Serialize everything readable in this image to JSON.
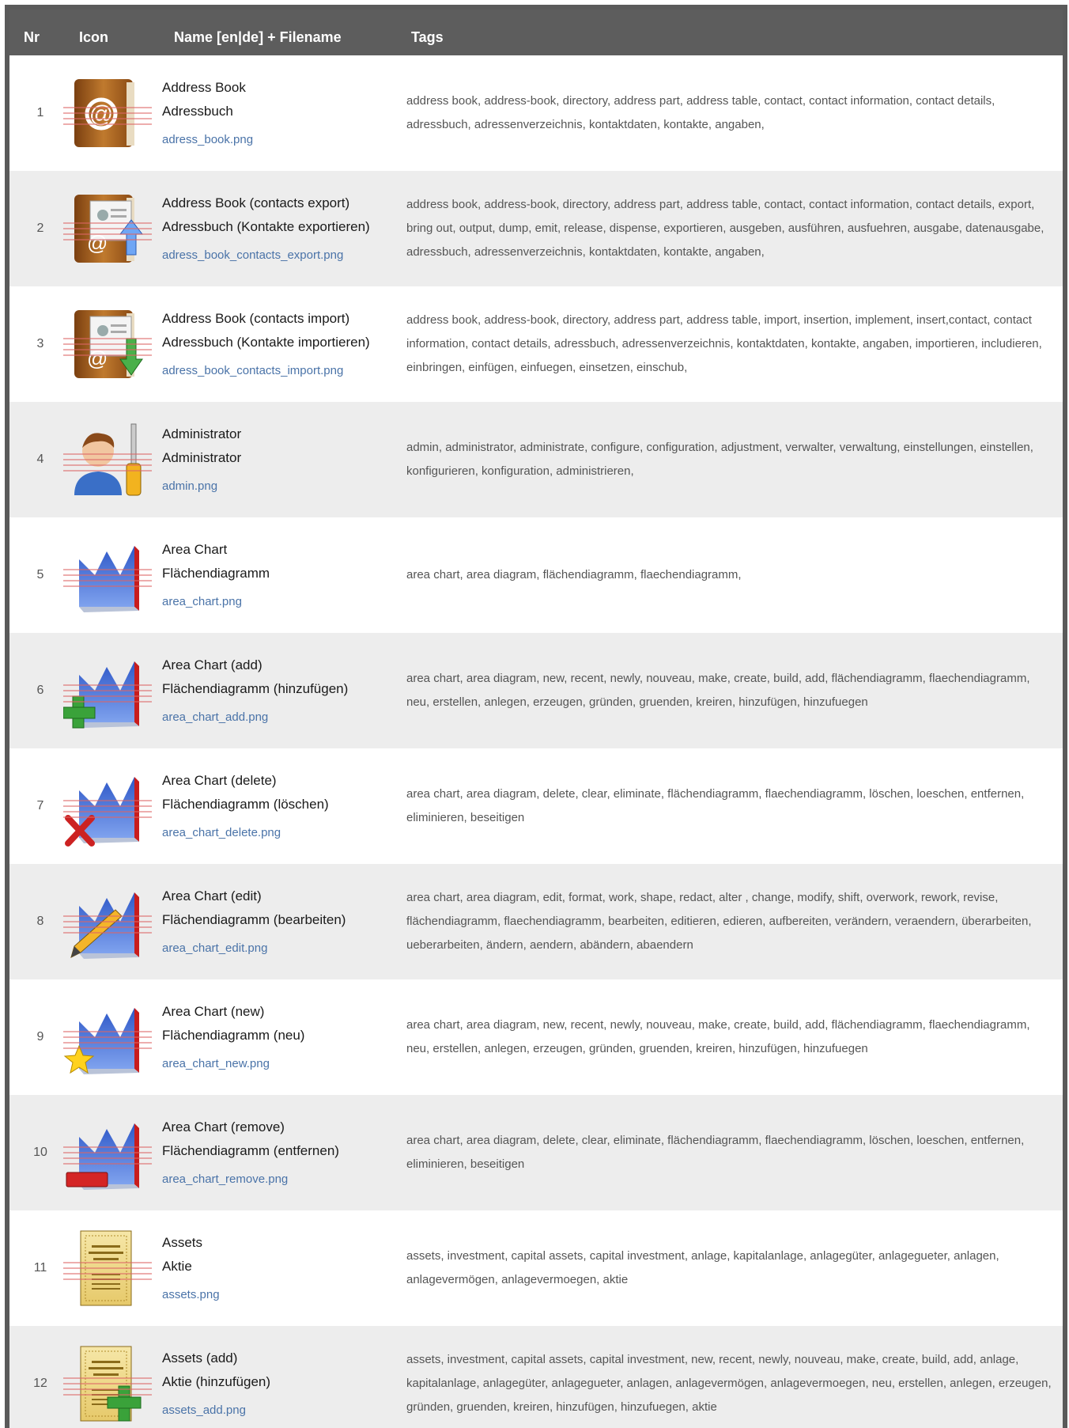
{
  "header": {
    "nr": "Nr",
    "icon": "Icon",
    "name": "Name [en|de] + Filename",
    "tags": "Tags"
  },
  "colors": {
    "header_bg": "#5d5d5d",
    "link": "#4a73a8",
    "row_alt": "#ededed"
  },
  "rows": [
    {
      "nr": "1",
      "icon": "address-book-icon",
      "en": "Address Book",
      "de": "Adressbuch",
      "file": "adress_book.png",
      "tags": "address book, address-book, directory, address part, address table, contact, contact information, contact details, adressbuch, adressenverzeichnis, kontaktdaten, kontakte, angaben,"
    },
    {
      "nr": "2",
      "icon": "address-book-export-icon",
      "en": "Address Book (contacts export)",
      "de": "Adressbuch (Kontakte exportieren)",
      "file": "adress_book_contacts_export.png",
      "tags": "address book, address-book, directory, address part, address table, contact, contact information, contact details, export, bring out, output, dump, emit, release, dispense, exportieren, ausgeben, ausführen, ausfuehren, ausgabe, datenausgabe, adressbuch, adressenverzeichnis, kontaktdaten, kontakte, angaben,"
    },
    {
      "nr": "3",
      "icon": "address-book-import-icon",
      "en": "Address Book (contacts import)",
      "de": "Adressbuch (Kontakte importieren)",
      "file": "adress_book_contacts_import.png",
      "tags": "address book, address-book, directory, address part, address table, import, insertion, implement, insert,contact, contact information, contact details, adressbuch, adressenverzeichnis, kontaktdaten, kontakte, angaben, importieren, includieren, einbringen, einfügen, einfuegen, einsetzen, einschub,"
    },
    {
      "nr": "4",
      "icon": "administrator-icon",
      "en": "Administrator",
      "de": "Administrator",
      "file": "admin.png",
      "tags": "admin, administrator, administrate, configure, configuration, adjustment, verwalter, verwaltung, einstellungen, einstellen, konfigurieren, konfiguration, administrieren,"
    },
    {
      "nr": "5",
      "icon": "area-chart-icon",
      "en": "Area Chart",
      "de": "Flächendiagramm",
      "file": "area_chart.png",
      "tags": "area chart, area diagram, flächendiagramm, flaechendiagramm,"
    },
    {
      "nr": "6",
      "icon": "area-chart-add-icon",
      "en": "Area Chart (add)",
      "de": "Flächendiagramm (hinzufügen)",
      "file": "area_chart_add.png",
      "tags": "area chart, area diagram, new, recent, newly, nouveau, make, create, build, add, flächendiagramm, flaechendiagramm, neu, erstellen, anlegen, erzeugen, gründen, gruenden, kreiren, hinzufügen, hinzufuegen"
    },
    {
      "nr": "7",
      "icon": "area-chart-delete-icon",
      "en": "Area Chart (delete)",
      "de": "Flächendiagramm (löschen)",
      "file": "area_chart_delete.png",
      "tags": "area chart, area diagram, delete, clear, eliminate, flächendiagramm, flaechendiagramm, löschen, loeschen, entfernen, eliminieren, beseitigen"
    },
    {
      "nr": "8",
      "icon": "area-chart-edit-icon",
      "en": "Area Chart (edit)",
      "de": "Flächendiagramm (bearbeiten)",
      "file": "area_chart_edit.png",
      "tags": "area chart, area diagram, edit, format, work, shape, redact, alter , change, modify, shift, overwork, rework, revise, flächendiagramm, flaechendiagramm, bearbeiten, editieren, edieren, aufbereiten, verändern, veraendern, überarbeiten, ueberarbeiten, ändern, aendern, abändern, abaendern"
    },
    {
      "nr": "9",
      "icon": "area-chart-new-icon",
      "en": "Area Chart (new)",
      "de": "Flächendiagramm (neu)",
      "file": "area_chart_new.png",
      "tags": "area chart, area diagram, new, recent, newly, nouveau, make, create, build, add, flächendiagramm, flaechendiagramm, neu, erstellen, anlegen, erzeugen, gründen, gruenden, kreiren, hinzufügen, hinzufuegen"
    },
    {
      "nr": "10",
      "icon": "area-chart-remove-icon",
      "en": "Area Chart (remove)",
      "de": "Flächendiagramm (entfernen)",
      "file": "area_chart_remove.png",
      "tags": "area chart, area diagram, delete, clear, eliminate, flächendiagramm, flaechendiagramm, löschen, loeschen, entfernen, eliminieren, beseitigen"
    },
    {
      "nr": "11",
      "icon": "assets-certificate-icon",
      "en": "Assets",
      "de": "Aktie",
      "file": "assets.png",
      "tags": "assets, investment, capital assets, capital investment, anlage, kapitalanlage, anlagegüter, anlagegueter, anlagen, anlagevermögen, anlagevermoegen, aktie"
    },
    {
      "nr": "12",
      "icon": "assets-add-icon",
      "en": "Assets (add)",
      "de": "Aktie (hinzufügen)",
      "file": "assets_add.png",
      "tags": "assets, investment, capital assets, capital investment, new, recent, newly, nouveau, make, create, build, add, anlage, kapitalanlage, anlagegüter, anlagegueter, anlagen, anlagevermögen, anlagevermoegen, neu, erstellen, anlegen, erzeugen, gründen, gruenden, kreiren, hinzufügen, hinzufuegen, aktie"
    }
  ]
}
